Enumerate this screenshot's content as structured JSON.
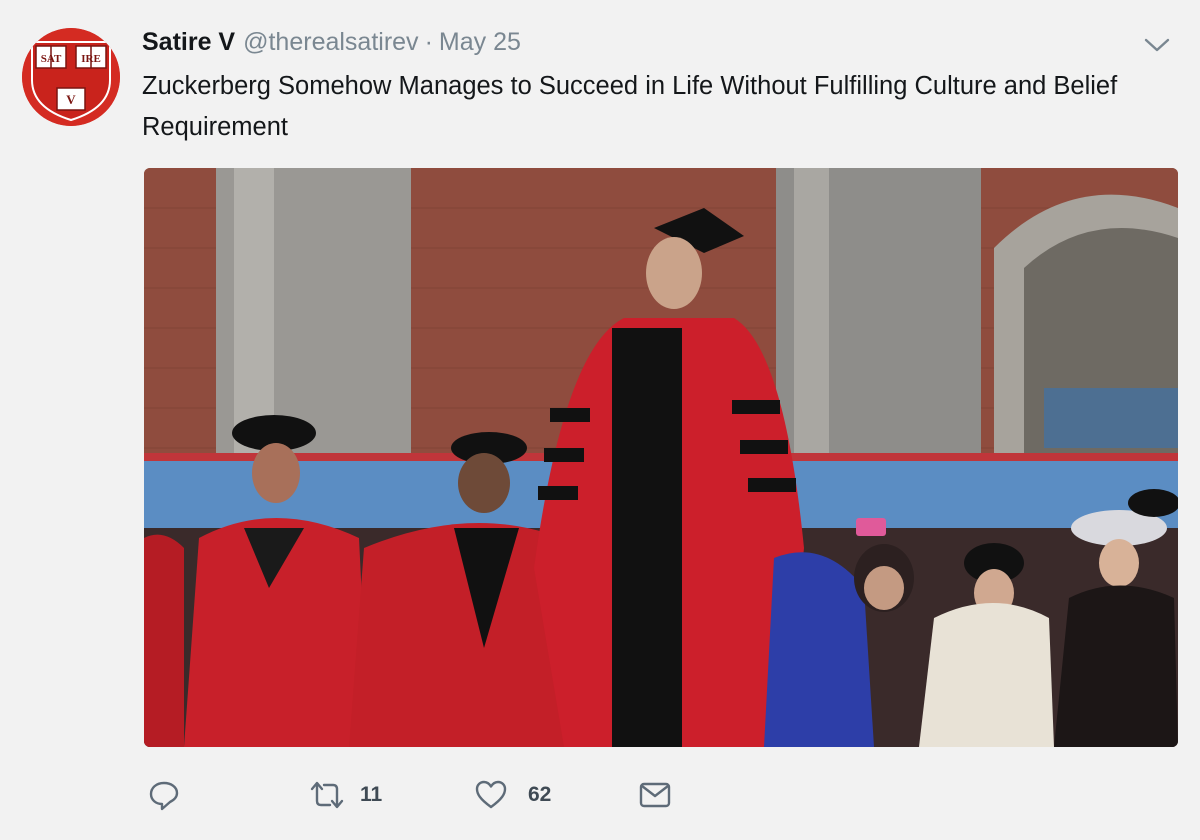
{
  "tweet": {
    "author_name": "Satire V",
    "handle": "@therealsatirev",
    "separator": "·",
    "date": "May 25",
    "text": "Zuckerberg Somehow Manages to Succeed in Life Without Fulfilling Culture and Belief Requirement"
  },
  "avatar": {
    "shield_texts": [
      "SAT",
      "IRE",
      "V"
    ],
    "colors": {
      "background": "#d42b22",
      "shield": "#ffffff"
    }
  },
  "actions": {
    "reply": {
      "icon": "reply-icon",
      "count": ""
    },
    "retweet": {
      "icon": "retweet-icon",
      "count": "11"
    },
    "like": {
      "icon": "heart-icon",
      "count": "62"
    },
    "message": {
      "icon": "envelope-icon",
      "count": ""
    }
  },
  "colors": {
    "icon": "#6b7885",
    "robe_red": "#c8202a",
    "brick": "#8a4a3c",
    "panel_blue": "#5a8cc4"
  }
}
